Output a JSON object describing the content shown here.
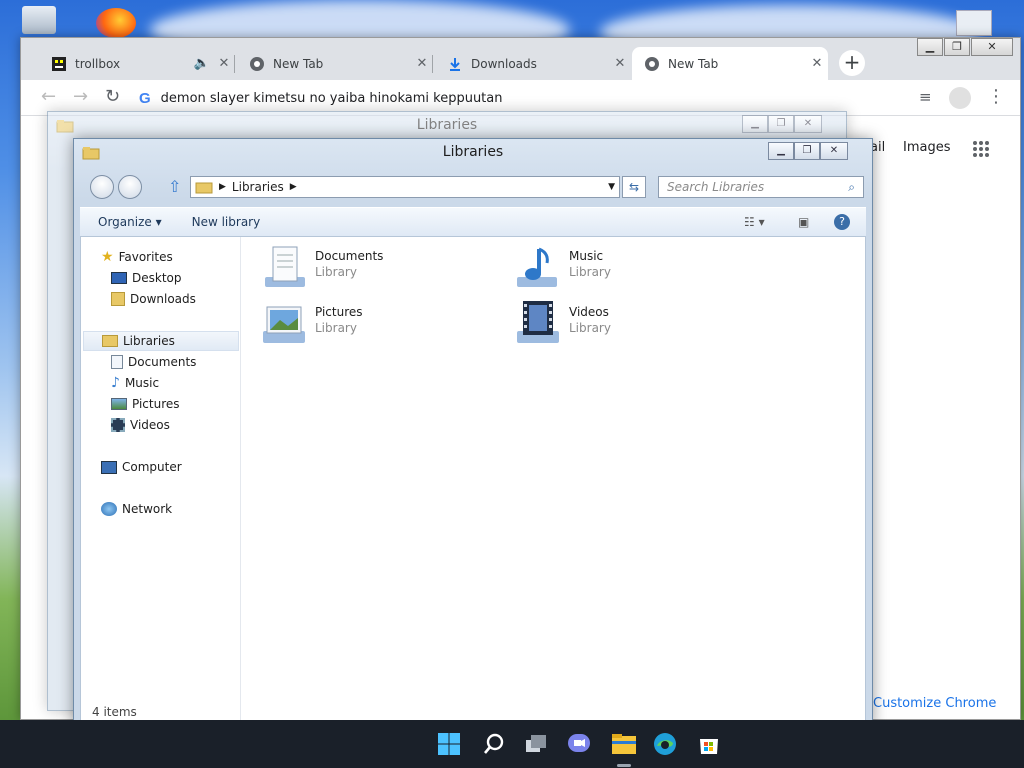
{
  "browser": {
    "tabs": [
      {
        "label": "trollbox",
        "icon": "trollbox-favicon-icon"
      },
      {
        "label": "New Tab",
        "icon": "chrome-icon"
      },
      {
        "label": "Downloads",
        "icon": "download-icon"
      },
      {
        "label": "New Tab",
        "icon": "chrome-icon",
        "active": true
      }
    ],
    "address": "demon slayer kimetsu no yaiba hinokami keppuutan",
    "links": {
      "gmail": "ail",
      "images": "Images"
    },
    "customize": "Customize Chrome"
  },
  "explorer": {
    "title": "Libraries",
    "breadcrumb": "Libraries",
    "search_placeholder": "Search Libraries",
    "commands": {
      "organize": "Organize",
      "new_library": "New library"
    },
    "nav": {
      "favorites": "Favorites",
      "desktop": "Desktop",
      "downloads": "Downloads",
      "libraries": "Libraries",
      "documents": "Documents",
      "music": "Music",
      "pictures": "Pictures",
      "videos": "Videos",
      "computer": "Computer",
      "network": "Network"
    },
    "items": [
      {
        "name": "Documents",
        "type": "Library"
      },
      {
        "name": "Music",
        "type": "Library"
      },
      {
        "name": "Pictures",
        "type": "Library"
      },
      {
        "name": "Videos",
        "type": "Library"
      }
    ],
    "status": "4 items"
  },
  "colors": {
    "accent": "#1a73e8",
    "taskbar": "#1a2029",
    "explorer_frame": "#cbd9e9"
  }
}
